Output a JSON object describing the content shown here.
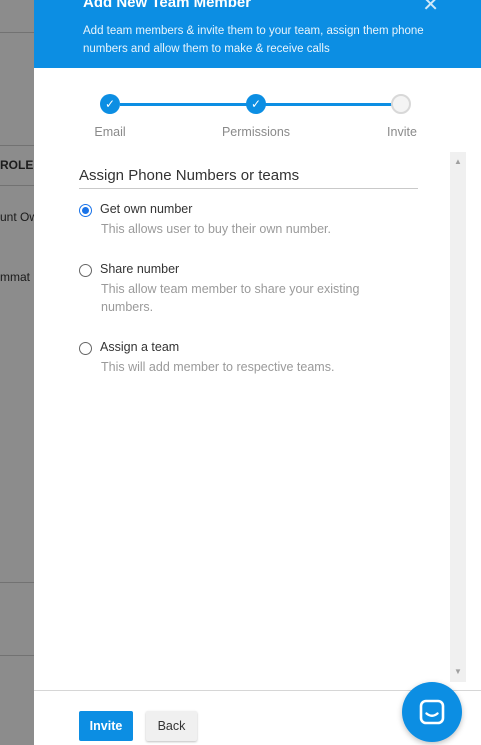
{
  "background": {
    "role_header": "ROLE",
    "row1_text": "unt Ow",
    "row2_text": "mmat"
  },
  "modal": {
    "title": "Add New Team Member",
    "subtitle": "Add team members & invite them to your team, assign them phone numbers and allow them to make & receive calls",
    "close_glyph": "✕"
  },
  "stepper": {
    "steps": [
      {
        "label": "Email",
        "state": "done"
      },
      {
        "label": "Permissions",
        "state": "done"
      },
      {
        "label": "Invite",
        "state": "pending"
      }
    ],
    "check_glyph": "✓"
  },
  "assign": {
    "section_title": "Assign Phone Numbers or teams",
    "options": [
      {
        "label": "Get own number",
        "description": "This allows user to buy their own number.",
        "selected": true
      },
      {
        "label": "Share number",
        "description": "This allow team member to share your existing numbers.",
        "selected": false
      },
      {
        "label": "Assign a team",
        "description": "This will add member to respective teams.",
        "selected": false
      }
    ]
  },
  "footer": {
    "invite_label": "Invite",
    "back_label": "Back"
  },
  "colors": {
    "accent": "#0c8ee3",
    "radio_selected": "#1a73e8"
  },
  "icons": {
    "chat": "chat-bubble-icon",
    "close": "close-icon",
    "scroll_up": "scroll-up-icon",
    "scroll_down": "scroll-down-icon"
  }
}
